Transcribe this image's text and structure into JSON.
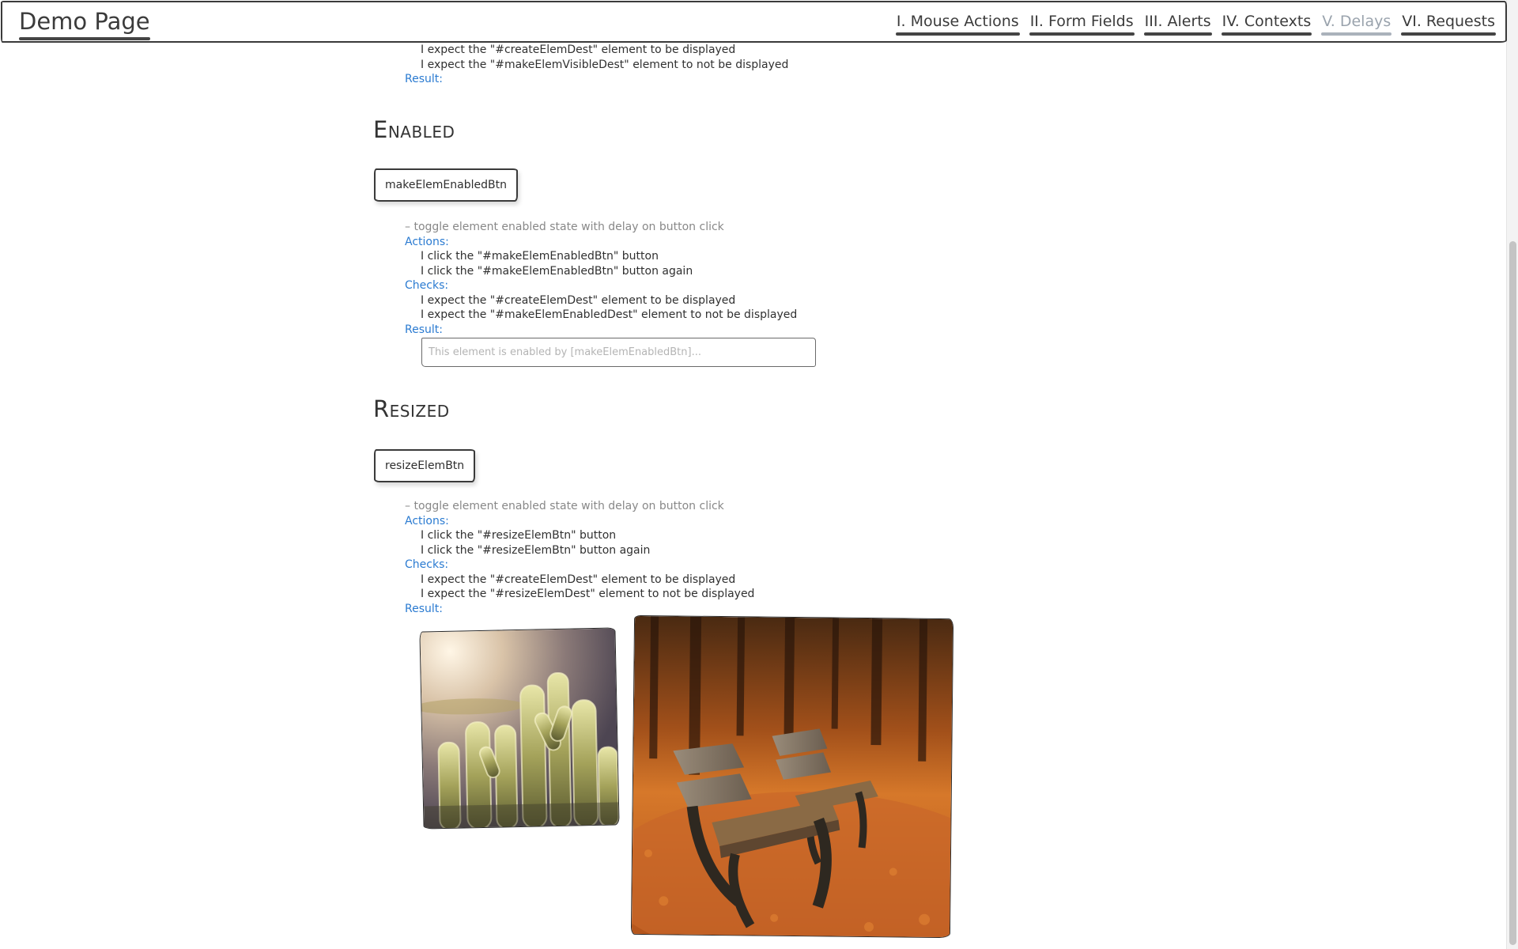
{
  "navbar": {
    "brand": "Demo Page",
    "links": [
      {
        "label": "I. Mouse Actions",
        "active": false
      },
      {
        "label": "II. Form Fields",
        "active": false
      },
      {
        "label": "III. Alerts",
        "active": false
      },
      {
        "label": "IV. Contexts",
        "active": false
      },
      {
        "label": "V. Delays",
        "active": true
      },
      {
        "label": "VI. Requests",
        "active": false
      }
    ]
  },
  "visible_section_tail": {
    "check_1": "I expect the \"#createElemDest\" element to be displayed",
    "check_2": "I expect the \"#makeElemVisibleDest\" element to not be displayed",
    "result_label": "Result:"
  },
  "enabled_section": {
    "heading": "Enabled",
    "button_label": "makeElemEnabledBtn",
    "description": "– toggle element enabled state with delay on button click",
    "actions_label": "Actions:",
    "actions": [
      "I click the \"#makeElemEnabledBtn\" button",
      "I click the \"#makeElemEnabledBtn\" button again"
    ],
    "checks_label": "Checks:",
    "checks": [
      "I expect the \"#createElemDest\" element to be displayed",
      "I expect the \"#makeElemEnabledDest\" element to not be displayed"
    ],
    "result_label": "Result:",
    "input_placeholder": "This element is enabled by [makeElemEnabledBtn]...",
    "input_value": ""
  },
  "resized_section": {
    "heading": "Resized",
    "button_label": "resizeElemBtn",
    "description": "– toggle element enabled state with delay on button click",
    "actions_label": "Actions:",
    "actions": [
      "I click the \"#resizeElemBtn\" button",
      "I click the \"#resizeElemBtn\" button again"
    ],
    "checks_label": "Checks:",
    "checks": [
      "I expect the \"#createElemDest\" element to be displayed",
      "I expect the \"#resizeElemDest\" element to not be displayed"
    ],
    "result_label": "Result:"
  },
  "images": [
    {
      "name": "cactus-image",
      "subject": "cactus plants in backlight"
    },
    {
      "name": "autumn-benches-image",
      "subject": "park benches on autumn leaves"
    }
  ],
  "colors": {
    "label_blue": "#2b7bd1",
    "description_gray": "#888888",
    "active_nav": "#9aa3ad",
    "border_dark": "#3a3a3a"
  }
}
